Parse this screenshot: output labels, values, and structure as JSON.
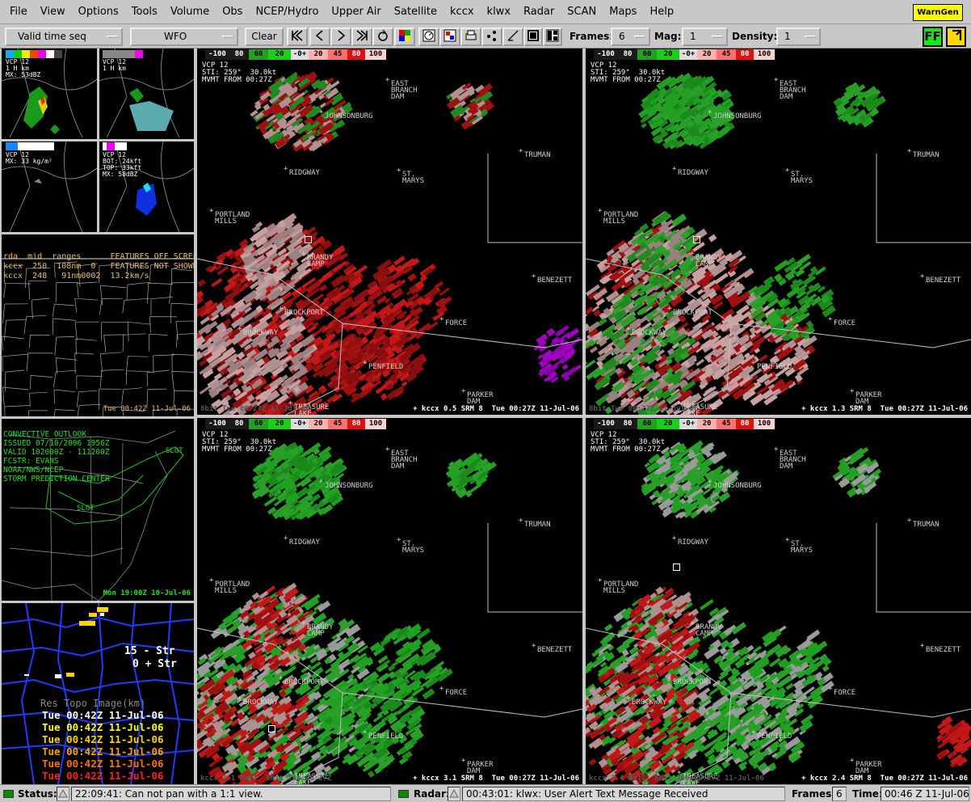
{
  "menu": [
    "File",
    "View",
    "Options",
    "Tools",
    "Volume",
    "Obs",
    "NCEP/Hydro",
    "Upper Air",
    "Satellite",
    "kccx",
    "klwx",
    "Radar",
    "SCAN",
    "Maps",
    "Help"
  ],
  "warngen_label": "WarnGen",
  "toolbar": {
    "time_seq": "Valid time seq",
    "scale": "WFO",
    "clear": "Clear",
    "frames_label": "Frames:",
    "frames_value": "6",
    "mag_label": "Mag:",
    "mag_value": "1",
    "density_label": "Density:",
    "density_value": "1",
    "ff": "FF",
    "loop_icons": [
      "first-frame-icon",
      "step-back-icon",
      "step-forward-icon",
      "last-frame-icon",
      "loop-icon"
    ]
  },
  "colorbar": [
    "-100",
    "80",
    "60",
    "20",
    "-0+",
    "20",
    "45",
    "80",
    "100"
  ],
  "radar_panels": [
    {
      "header": "VCP 12\nSTI: 259°  30.0kt\nMVMT FROM 00:27Z",
      "footer_left": "8bit Tue 00:27Z 11-Jul-06",
      "footer_right": "+ kccx 0.5 SRM 8  Tue 00:27Z 11-Jul-06"
    },
    {
      "header": "VCP 12\nSTI: 259°  30.0kt\nMVMT FROM 00:27Z",
      "footer_left": "8bit Tue 00:27Z 11-Jul-06",
      "footer_right": "+ kccx 1.3 SRM 8  Tue 00:27Z 11-Jul-06"
    },
    {
      "header": "VCP 12\nSTI: 259°  30.0kt\nMVMT FROM 00:27Z",
      "footer_left": "kccx 3.1 Refl  8bit Tue 00:27Z",
      "footer_right": "+ kccx 3.1 SRM 8  Tue 00:27Z 11-Jul-06"
    },
    {
      "header": "VCP 12\nSTI: 259°  30.0kt\nMVMT FROM 00:27Z",
      "footer_left": "kccx 2.4 Refl  8bit Tue 00:27Z 11-Jul-06",
      "footer_right": "+ kccx 2.4 SRM 8  Tue 00:27Z 11-Jul-06"
    }
  ],
  "places": [
    "EAST\nBRANCH\nDAM",
    "JOHNSONBURG",
    "TRUMAN",
    "RIDGWAY",
    "ST.\nMARYS",
    "PORTLAND\nMILLS",
    "BRANDY\nCAMP",
    "BENEZETT",
    "BROCKPORT",
    "FORCE",
    "BROCKWAY",
    "PENFIELD",
    "PARKER\nDAM",
    "TREASURE\nLAKE"
  ],
  "side": {
    "thumb1": "VCP 12\n1 H km\nMX: 53dBZ",
    "thumb2": "VCP 12\n1 H km",
    "thumb3": "VCP 12\nMX: 33 kg/m²",
    "thumb4": "VCP 12\nBOT: 24kft\nTOP: 33kft\nMX: 58dBZ",
    "panel2_text": "rda  mid  ranges      FEATURES OFF SCREEN\nkccx  250  108nm  0   FEATURES NOT SHOWN\nkccx  248   91nm0002  13.2km/s",
    "panel2_footer": "Tue 00:42Z 11-Jul-06",
    "outlook": "CONVECTIVE OUTLOOK\nISSUED 07/10/2006 1956Z\nVALID 102000Z - 111200Z\nFCSTR: EVANS\nNOAA/NWS/NCEP\nSTORM PREDICTION CENTER",
    "outlook_slgt1": "SLGT",
    "outlook_slgt2": "SLGT",
    "outlook_footer": "Mon 19:00Z 10-Jul-06",
    "strike_plus": "15 - Str",
    "strike_minus": "0 + Str",
    "topo": "Res Topo Image(km)",
    "times": [
      "Tue 00:42Z 11-Jul-06",
      "Tue 00:42Z 11-Jul-06",
      "Tue 00:42Z 11-Jul-06",
      "Tue 00:42Z 11-Jul-06",
      "Tue 00:42Z 11-Jul-06",
      "Tue 00:42Z 11-Jul-06"
    ],
    "time_colors": [
      "#ffffff",
      "#ffff00",
      "#ffd400",
      "#ffa000",
      "#ff7000",
      "#ff2020"
    ]
  },
  "status": {
    "label": "Status:",
    "message": "22:09:41: Can not pan with a 1:1 view.",
    "radar_label": "Radar:",
    "radar_message": "00:43:01: klwx: User Alert Text Message Received",
    "frames_label": "Frames:",
    "frames_value": "6",
    "time_label": "Time:",
    "time_value": "00:46 Z 11-Jul-06"
  }
}
